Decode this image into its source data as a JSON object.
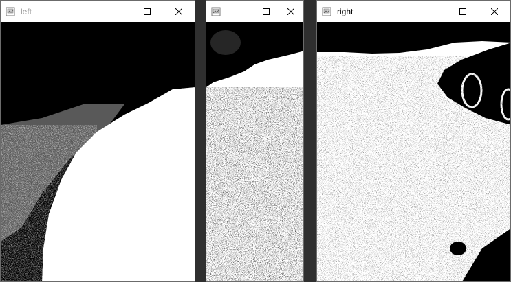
{
  "windows": {
    "left": {
      "title": "left",
      "minimize_icon": "minimize-icon",
      "maximize_icon": "maximize-icon",
      "close_icon": "close-icon",
      "image_description_icon": "app-icon"
    },
    "middle": {
      "title": "",
      "minimize_icon": "minimize-icon",
      "maximize_icon": "maximize-icon",
      "close_icon": "close-icon"
    },
    "right": {
      "title": "right",
      "minimize_icon": "minimize-icon",
      "maximize_icon": "maximize-icon",
      "close_icon": "close-icon"
    }
  },
  "colors": {
    "titlebar_bg": "#ffffff",
    "inactive_title_text": "#9a9a9a",
    "active_title_text": "#000000",
    "image_black": "#000000",
    "image_white": "#ffffff",
    "desktop_bg": "#2f2f2f"
  }
}
